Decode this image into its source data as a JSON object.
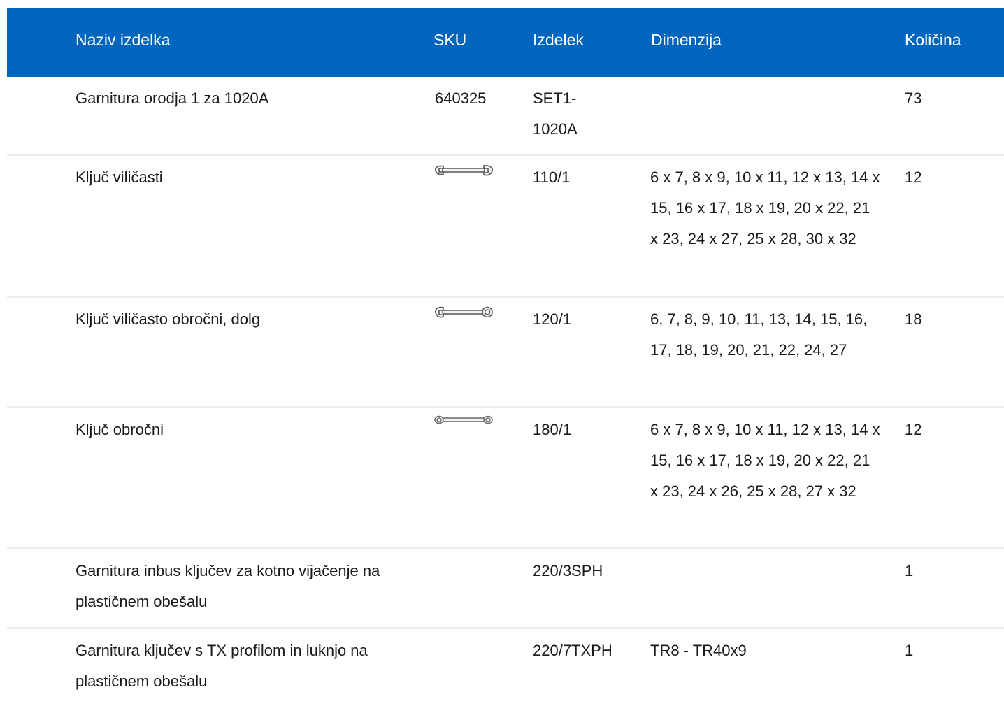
{
  "table": {
    "headers": {
      "name": "Naziv izdelka",
      "sku": "SKU",
      "item": "Izdelek",
      "dimension": "Dimenzija",
      "quantity": "Količina"
    },
    "rows": [
      {
        "name": "Garnitura orodja 1 za 1020A",
        "sku": "640325",
        "item": "SET1-\n1020A",
        "dimension": "",
        "quantity": "73",
        "icon": ""
      },
      {
        "name": "Ključ viličasti",
        "sku": "",
        "item": "110/1",
        "dimension": "6 x 7, 8 x 9, 10 x 11, 12 x 13, 14 x 15, 16 x 17, 18 x 19, 20 x 22, 21 x 23, 24 x 27, 25 x 28, 30 x 32",
        "quantity": "12",
        "icon": "open-end-wrench-icon"
      },
      {
        "name": "Ključ viličasto obročni, dolg",
        "sku": "",
        "item": "120/1",
        "dimension": "6, 7, 8, 9, 10, 11, 13, 14, 15, 16, 17, 18, 19, 20, 21, 22, 24, 27",
        "quantity": "18",
        "icon": "combination-wrench-icon"
      },
      {
        "name": "Ključ obročni",
        "sku": "",
        "item": "180/1",
        "dimension": "6 x 7, 8 x 9, 10 x 11, 12 x 13, 14 x 15, 16 x 17, 18 x 19, 20 x 22, 21 x 23, 24 x 26, 25 x 28, 27 x 32",
        "quantity": "12",
        "icon": "ring-wrench-icon"
      },
      {
        "name": "Garnitura inbus ključev za kotno vijačenje na plastičnem obešalu",
        "sku": "",
        "item": "220/3SPH",
        "dimension": "",
        "quantity": "1",
        "icon": ""
      },
      {
        "name": "Garnitura ključev s TX profilom in luknjo na plastičnem obešalu",
        "sku": "",
        "item": "220/7TXPH",
        "dimension": "TR8 - TR40x9",
        "quantity": "1",
        "icon": ""
      }
    ]
  },
  "colors": {
    "header_bg": "#0066bd",
    "header_text": "#ffffff",
    "divider": "#ececec"
  }
}
